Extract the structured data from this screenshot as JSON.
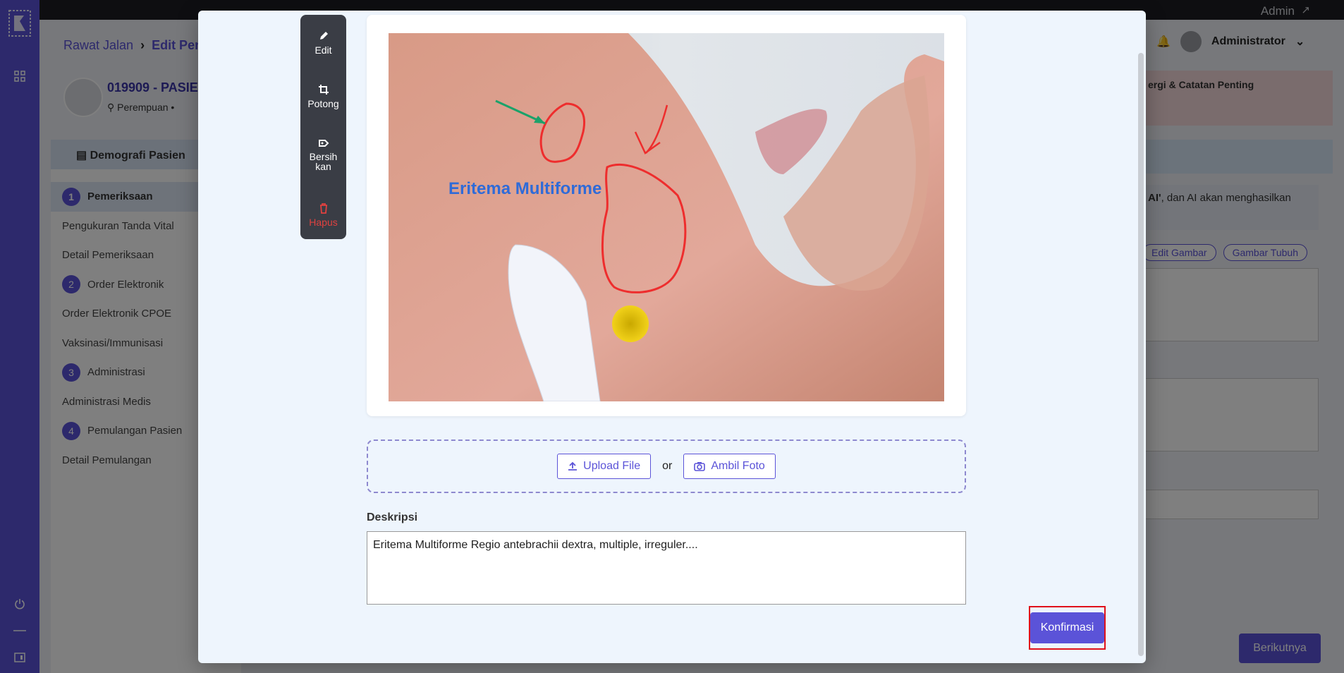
{
  "topbar": {
    "user_label": "Admin"
  },
  "header": {
    "username": "Administrator"
  },
  "breadcrumb": {
    "parent": "Rawat Jalan",
    "current": "Edit Pen"
  },
  "patient": {
    "id_name": "019909 - PASIE",
    "gender": "Perempuan"
  },
  "tabs": {
    "demografi": "Demografi Pasien"
  },
  "sidebar": {
    "items": [
      {
        "num": "1",
        "label": "Pemeriksaan"
      },
      {
        "label": "Pengukuran Tanda Vital"
      },
      {
        "label": "Detail Pemeriksaan"
      },
      {
        "num": "2",
        "label": "Order Elektronik"
      },
      {
        "label": "Order Elektronik CPOE"
      },
      {
        "label": "Vaksinasi/Immunisasi"
      },
      {
        "num": "3",
        "label": "Administrasi"
      },
      {
        "label": "Administrasi Medis"
      },
      {
        "num": "4",
        "label": "Pemulangan Pasien"
      },
      {
        "label": "Detail Pemulangan"
      }
    ]
  },
  "right_panel": {
    "allergy_title": "ergi & Catatan Penting",
    "ai_info_bold": "AI'",
    "ai_info_rest": ", dan AI akan menghasilkan",
    "edit_image_label": "Edit Gambar",
    "body_image_label": "Gambar Tubuh",
    "next_button": "Berikutnya"
  },
  "modal": {
    "tools": {
      "edit": "Edit",
      "crop": "Potong",
      "clear": "Bersih kan",
      "delete": "Hapus"
    },
    "image_annotation_text": "Eritema Multiforme",
    "upload_button": "Upload File",
    "or_label": "or",
    "take_photo_button": "Ambil Foto",
    "description_label": "Deskripsi",
    "description_value": "Eritema Multiforme Regio antebrachii dextra, multiple, irreguler....",
    "confirm_button": "Konfirmasi"
  },
  "colors": {
    "accent": "#5b53d8",
    "danger": "#e0413f",
    "highlight_border": "#e0111b"
  }
}
